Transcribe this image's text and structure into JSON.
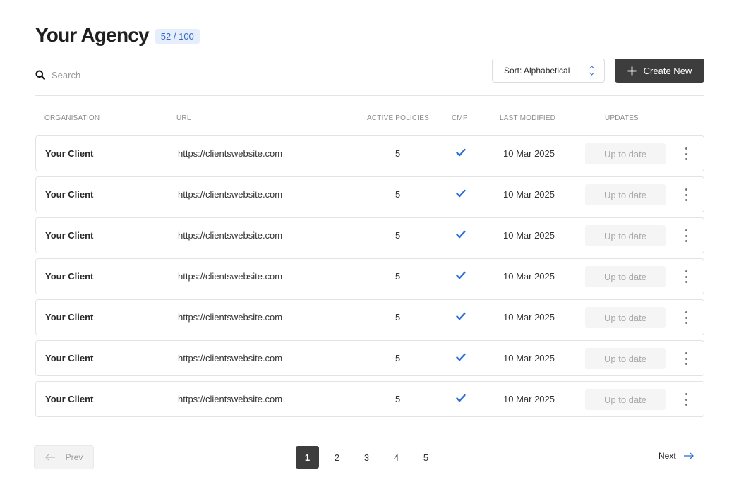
{
  "header": {
    "title": "Your Agency",
    "count": "52 / 100"
  },
  "search": {
    "placeholder": "Search"
  },
  "toolbar": {
    "sort_label": "Sort: Alphabetical",
    "create_label": "Create New"
  },
  "table": {
    "columns": [
      "ORGANISATION",
      "URL",
      "ACTIVE POLICIES",
      "CMP",
      "LAST MODIFIED",
      "UPDATES"
    ],
    "rows": [
      {
        "organisation": "Your Client",
        "url": "https://clientswebsite.com",
        "active_policies": "5",
        "cmp": "check-icon",
        "last_modified": "10 Mar 2025",
        "updates": "Up to date"
      },
      {
        "organisation": "Your Client",
        "url": "https://clientswebsite.com",
        "active_policies": "5",
        "cmp": "check-icon",
        "last_modified": "10 Mar 2025",
        "updates": "Up to date"
      },
      {
        "organisation": "Your Client",
        "url": "https://clientswebsite.com",
        "active_policies": "5",
        "cmp": "check-icon",
        "last_modified": "10 Mar 2025",
        "updates": "Up to date"
      },
      {
        "organisation": "Your Client",
        "url": "https://clientswebsite.com",
        "active_policies": "5",
        "cmp": "check-icon",
        "last_modified": "10 Mar 2025",
        "updates": "Up to date"
      },
      {
        "organisation": "Your Client",
        "url": "https://clientswebsite.com",
        "active_policies": "5",
        "cmp": "check-icon",
        "last_modified": "10 Mar 2025",
        "updates": "Up to date"
      },
      {
        "organisation": "Your Client",
        "url": "https://clientswebsite.com",
        "active_policies": "5",
        "cmp": "check-icon",
        "last_modified": "10 Mar 2025",
        "updates": "Up to date"
      },
      {
        "organisation": "Your Client",
        "url": "https://clientswebsite.com",
        "active_policies": "5",
        "cmp": "check-icon",
        "last_modified": "10 Mar 2025",
        "updates": "Up to date"
      }
    ]
  },
  "pagination": {
    "prev_label": "Prev",
    "next_label": "Next",
    "pages": [
      "1",
      "2",
      "3",
      "4",
      "5"
    ],
    "current": "1"
  },
  "colors": {
    "accent": "#2b6fd6",
    "badge_bg": "#e6eefb",
    "badge_text": "#3569c7",
    "primary_button": "#3d3d3d"
  }
}
